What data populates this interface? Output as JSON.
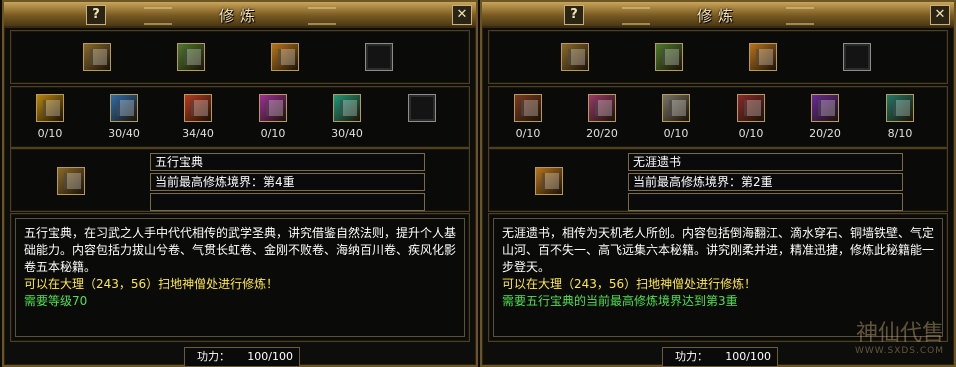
{
  "colors": {
    "frame_gold": "#6b5524",
    "text_white": "#ffffff",
    "text_yellow": "#ffe84a",
    "text_green": "#4ee24e"
  },
  "left_panel": {
    "title": "修炼",
    "help_icon": "question-mark-icon",
    "close_icon": "close-x-icon",
    "top_books": [
      {
        "icon": "book-rainbow-icon",
        "color": "#8b6a2a"
      },
      {
        "icon": "book-green-scroll-icon",
        "color": "#4e7a2c"
      },
      {
        "icon": "book-golden-chest-icon",
        "color": "#b8741a"
      }
    ],
    "top_empty_slot": "empty-slot",
    "sub_books": [
      {
        "icon": "book-yellow-icon",
        "color": "#b8860b",
        "count": "0/10"
      },
      {
        "icon": "book-blue-icon",
        "color": "#2b6fb0",
        "count": "30/40"
      },
      {
        "icon": "book-red-icon",
        "color": "#b83a1f",
        "count": "34/40"
      },
      {
        "icon": "book-magenta-icon",
        "color": "#a02f9a",
        "count": "0/10"
      },
      {
        "icon": "book-cyan-icon",
        "color": "#1e9a7a",
        "count": "30/40"
      }
    ],
    "selected_book_icon": "book-rainbow-icon",
    "selected_book_color": "#8b6a2a",
    "book_name": "五行宝典",
    "realm": "当前最高修炼境界：第4重",
    "extra": "",
    "desc_white": "五行宝典，在习武之人手中代代相传的武学圣典，讲究借鉴自然法则，提升个人基础能力。内容包括力拔山兮卷、气贯长虹卷、金刚不败卷、海纳百川卷、疾风化影卷五本秘籍。",
    "desc_yellow": "可以在大理（243，56）扫地神僧处进行修炼！",
    "desc_green": "需要等级70",
    "gongli_label": "功力：",
    "gongli_value": "100/100"
  },
  "right_panel": {
    "title": "修炼",
    "help_icon": "question-mark-icon",
    "close_icon": "close-x-icon",
    "top_books": [
      {
        "icon": "book-rainbow-icon",
        "color": "#8b6a2a"
      },
      {
        "icon": "book-green-scroll-icon",
        "color": "#4e7a2c"
      },
      {
        "icon": "book-golden-chest-icon",
        "color": "#b8741a"
      }
    ],
    "top_empty_slot": "empty-slot",
    "sub_books": [
      {
        "icon": "scroll-brown-icon",
        "color": "#7a3a22",
        "count": "0/10"
      },
      {
        "icon": "scroll-pink-icon",
        "color": "#9a3a6a",
        "count": "20/20"
      },
      {
        "icon": "scroll-gray-icon",
        "color": "#7a7468",
        "count": "0/10"
      },
      {
        "icon": "scroll-red-icon",
        "color": "#8a2a2a",
        "count": "0/10"
      },
      {
        "icon": "scroll-purple-icon",
        "color": "#6a2a9a",
        "count": "20/20"
      },
      {
        "icon": "scroll-teal-icon",
        "color": "#1f7a6a",
        "count": "8/10"
      }
    ],
    "selected_book_icon": "book-golden-chest-icon",
    "selected_book_color": "#b8741a",
    "book_name": "无涯遗书",
    "realm": "当前最高修炼境界：第2重",
    "extra": "",
    "desc_white": "无涯遗书，相传为天机老人所创。内容包括倒海翻江、滴水穿石、铜墙铁壁、气定山河、百不失一、高飞远集六本秘籍。讲究刚柔并进，精准迅捷，修炼此秘籍能一步登天。",
    "desc_yellow": "可以在大理（243，56）扫地神僧处进行修炼！",
    "desc_green": "需要五行宝典的当前最高修炼境界达到第3重",
    "gongli_label": "功力：",
    "gongli_value": "100/100"
  },
  "watermark": {
    "logo_text": "神仙代售",
    "url": "WWW.SXDS.COM"
  }
}
